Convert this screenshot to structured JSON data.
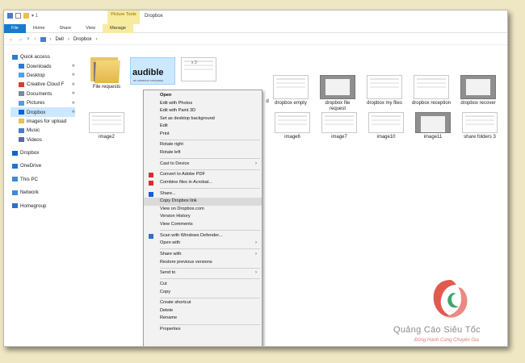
{
  "window": {
    "title": "Dropbox",
    "qat_marker": "▾ 1",
    "contextual_tab_group": "Picture Tools"
  },
  "ribbon": {
    "tabs": [
      "File",
      "Home",
      "Share",
      "View",
      "Manage"
    ]
  },
  "address": {
    "back": "←",
    "forward": "→",
    "recent": "˅",
    "up": "↑",
    "path": [
      "Dell",
      "Dropbox"
    ],
    "separator": "›"
  },
  "nav": {
    "items": [
      {
        "label": "Quick access",
        "icon": "star-icon",
        "color": "#2b7cd3",
        "pinned": false
      },
      {
        "label": "Downloads",
        "icon": "download-icon",
        "color": "#2b7cd3",
        "pinned": true
      },
      {
        "label": "Desktop",
        "icon": "desktop-icon",
        "color": "#4aa3e8",
        "pinned": true
      },
      {
        "label": "Creative Cloud F",
        "icon": "creative-cloud-icon",
        "color": "#da3b2e",
        "pinned": true
      },
      {
        "label": "Documents",
        "icon": "documents-icon",
        "color": "#7a8a9e",
        "pinned": true
      },
      {
        "label": "Pictures",
        "icon": "pictures-icon",
        "color": "#5b9bd5",
        "pinned": true
      },
      {
        "label": "Dropbox",
        "icon": "dropbox-icon",
        "color": "#0f62d6",
        "pinned": true,
        "selected": true
      },
      {
        "label": "images for upload",
        "icon": "folder-icon",
        "color": "#e8c24a",
        "pinned": false
      },
      {
        "label": "Music",
        "icon": "music-icon",
        "color": "#4a7cc7",
        "pinned": false
      },
      {
        "label": "Videos",
        "icon": "videos-icon",
        "color": "#5b6ba5",
        "pinned": false
      }
    ],
    "roots": [
      {
        "label": "Dropbox",
        "icon": "dropbox-icon",
        "color": "#0f62d6"
      },
      {
        "label": "OneDrive",
        "icon": "onedrive-icon",
        "color": "#1e73d8"
      },
      {
        "label": "This PC",
        "icon": "pc-icon",
        "color": "#3c8ad8"
      },
      {
        "label": "Network",
        "icon": "network-icon",
        "color": "#3c8ad8"
      },
      {
        "label": "Homegroup",
        "icon": "homegroup-icon",
        "color": "#2a6fc9"
      }
    ],
    "pin_glyph": "✲"
  },
  "files": {
    "row1": [
      {
        "label": "File requests",
        "kind": "folder"
      },
      {
        "label": "",
        "kind": "audible",
        "logo": "audible",
        "sub": "an amazon company"
      },
      {
        "label": "",
        "kind": "light",
        "mark": "x 3"
      },
      {
        "label": "",
        "kind": "light"
      },
      {
        "label": "d",
        "kind": "light"
      },
      {
        "label": "dropbox empty",
        "kind": "light"
      },
      {
        "label": "dropbox file request",
        "kind": "dark"
      },
      {
        "label": "dropbox my files",
        "kind": "light"
      },
      {
        "label": "dropbox reception",
        "kind": "light"
      },
      {
        "label": "dropbox recover",
        "kind": "dark"
      }
    ],
    "row2": [
      {
        "label": "image2",
        "kind": "light"
      },
      {
        "label": "image6",
        "kind": "light"
      },
      {
        "label": "image7",
        "kind": "light"
      },
      {
        "label": "image10",
        "kind": "light"
      },
      {
        "label": "image11",
        "kind": "dark"
      },
      {
        "label": "share folders 3",
        "kind": "light"
      }
    ]
  },
  "context_menu": {
    "groups": [
      [
        {
          "label": "Open",
          "bold": true
        },
        {
          "label": "Edit with Photos"
        },
        {
          "label": "Edit with Paint 3D"
        },
        {
          "label": "Set as desktop background"
        },
        {
          "label": "Edit"
        },
        {
          "label": "Print"
        }
      ],
      [
        {
          "label": "Rotate right"
        },
        {
          "label": "Rotate left"
        }
      ],
      [
        {
          "label": "Cast to Device",
          "submenu": true
        }
      ],
      [
        {
          "label": "Convert to Adobe PDF",
          "icon": "adobe-pdf-icon",
          "color": "#d32f2f"
        },
        {
          "label": "Combine files in Acrobat...",
          "icon": "acrobat-icon",
          "color": "#d32f2f"
        }
      ],
      [
        {
          "label": "Share...",
          "icon": "dropbox-icon",
          "color": "#0f62d6"
        },
        {
          "label": "Copy Dropbox link",
          "highlighted": true
        },
        {
          "label": "View on Dropbox.com"
        },
        {
          "label": "Version History"
        },
        {
          "label": "View Comments"
        }
      ],
      [
        {
          "label": "Scan with Windows Defender...",
          "icon": "defender-icon",
          "color": "#2a73c9"
        },
        {
          "label": "Open with",
          "submenu": true
        }
      ],
      [
        {
          "label": "Share with",
          "submenu": true
        },
        {
          "label": "Restore previous versions"
        }
      ],
      [
        {
          "label": "Send to",
          "submenu": true
        }
      ],
      [
        {
          "label": "Cut"
        },
        {
          "label": "Copy"
        }
      ],
      [
        {
          "label": "Create shortcut"
        },
        {
          "label": "Delete"
        },
        {
          "label": "Rename"
        }
      ],
      [
        {
          "label": "Properties"
        }
      ]
    ],
    "submenu_glyph": "›"
  },
  "watermark": {
    "title": "Quảng Cáo Siêu Tốc",
    "subtitle": "Đồng Hành Cùng Chuyên Gia",
    "colors": {
      "red": "#e05a50",
      "green": "#3fa56a",
      "gray": "#8b8b8b"
    }
  }
}
